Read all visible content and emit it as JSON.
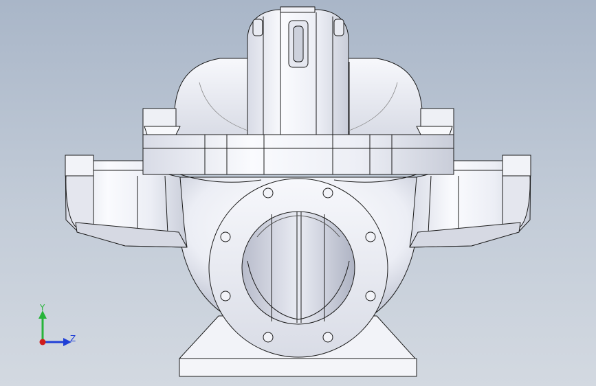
{
  "viewport": {
    "background_top": "#a9b6c8",
    "background_bottom": "#d3d9e1"
  },
  "model": {
    "subject": "split-case pump",
    "view": "front",
    "body_color": "#eef0f6",
    "edge_color": "#1a1a1a"
  },
  "triad": {
    "y_label": "Y",
    "z_label": "Z",
    "y_color": "#27b43a",
    "z_color": "#1f3fd6",
    "x_color": "#d01c1c"
  }
}
